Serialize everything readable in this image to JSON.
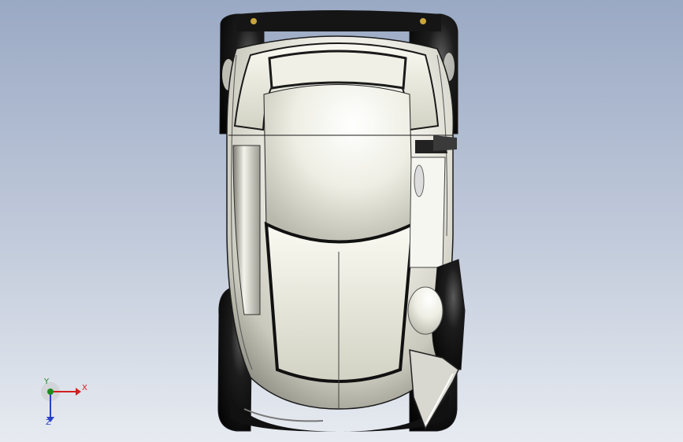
{
  "viewport": {
    "background_top": "#9aa9c4",
    "background_bottom": "#e7ebf1"
  },
  "model": {
    "body_color": "#f3f3ec",
    "wheel_color": "#141414",
    "outline_color": "#1a1a1a"
  },
  "triad": {
    "x_label": "X",
    "y_label": "Y",
    "z_label": "Z",
    "x_color": "#d22020",
    "y_color": "#1e8a1e",
    "z_color": "#2840c8"
  }
}
